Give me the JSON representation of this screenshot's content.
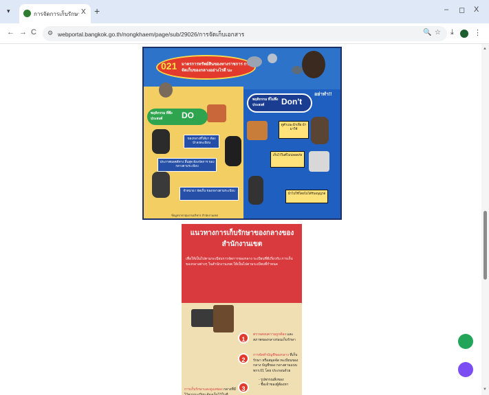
{
  "browser": {
    "tab_title": "การจัดการเก็บรักษาเอกสาร",
    "tab_list_symbol": "▾",
    "tab_close_symbol": "X",
    "new_tab_symbol": "+",
    "window_minimize": "–",
    "window_restore": "◻",
    "window_close": "X",
    "back_symbol": "←",
    "forward_symbol": "→",
    "reload_symbol": "C",
    "site_info_symbol": "⚙",
    "url": "webportal.bangkok.go.th/nongkhaem/page/sub/29026/การจัดเก็บเอกสาร",
    "zoom_symbol": "🔍",
    "bookmark_symbol": "☆",
    "download_symbol": "⤓",
    "menu_symbol": "⋮"
  },
  "infographic_1": {
    "badge": "021",
    "title": "มาตรการทรัพย์สินของทางราชการ การจัดเก็บของกลางอย่างไรดี นะ",
    "do_label": "พฤติกรรม ที่พึงประสงค์",
    "do_word": "DO",
    "dont_label": "พฤติกรรม ที่ไม่พึงประสงค์",
    "dont_word": "Don't",
    "avoid_note": "อย่าทำ!!",
    "do_items": [
      "ของกลางที่ได้มา ต้องนำลงทะเบียน",
      "ประกาศผลคดีทาง สิ้นสุด ต้องจัดการ ของกลางตามระเบียบ",
      "จำหน่าย / จัดเก็บ ของกลางตามระเบียบ"
    ],
    "dont_items": [
      "ดูคำแนะนำเพื่อ นำมาใช้",
      "เก็บไว้ในที่ไม่ปลอดภัย",
      "นำไปใช้โดยไม่ได้รับอนุญาต"
    ],
    "footer": "ข้อมูลจากกลุ่มงานบริหาร สำนักงานเขต"
  },
  "infographic_2": {
    "title": "แนวทางการเก็บรักษาของกลางของ สำนักงานเขต",
    "desc": "เพื่อให้เป็นไปตามระเบียบการจัดการของกลาง ระเบียบที่ดีเกี่ยวกับ การเก็บของกลางต่างๆ ในสำนักงานเขต ให้เป็นไปตามระเบียบที่กำหนด",
    "steps": [
      {
        "num": "1",
        "hl": "ตรวจสอบความถูกต้อง",
        "text": "และ สภาพของกลางก่อนเก็บรักษา"
      },
      {
        "num": "2",
        "hl": "การจัดทำบัญชีของกลาง",
        "text": "ที่เก็บรักษา หรือสมุดจัด ทะเบียนของกลาง บัญชีของ กลางตามแบบ ทกร.01 โดย ประกอบด้วย"
      },
      {
        "num": "3",
        "hl": "การเก็บรักษาและดูแลของ",
        "text": "กลางที่มีไว้ตามระเบียบ ต้องเก็บไว้ในที่ปลอดภัย"
      }
    ],
    "bullets": [
      "- รูปพรรณสิ่งของ",
      "- ชื่อเจ้าของผู้ต้องหา",
      "- ชื่อของกลาง",
      "- ชื่อเจ้าของหรือผู้ครอบครอง"
    ],
    "left_note": "โดยให้มีบุคคลสำหรับรักษา สถานที่รักษาของกลาง 2 คน ผู้รักษาของกลางมีหน้าที่"
  }
}
